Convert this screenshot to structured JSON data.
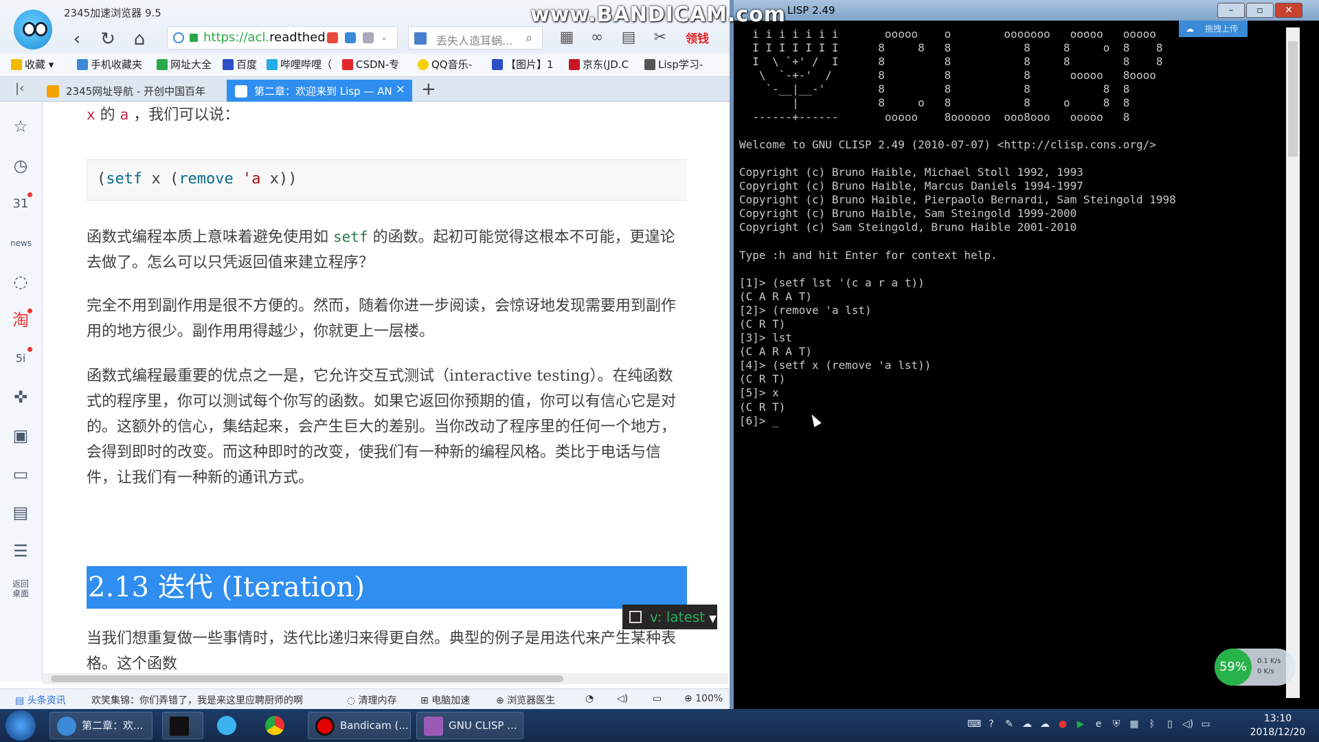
{
  "browser": {
    "title": "2345加速浏览器 9.5",
    "url_prefix": "https://acl.",
    "url_host": "readthed",
    "search_placeholder": "丢失人造耳蜗...",
    "red_button": "领钱",
    "bookmarks": [
      "收藏",
      "手机收藏夹",
      "网址大全",
      "百度",
      "哔哩哔哩（",
      "CSDN-专",
      "QQ音乐-",
      "【图片】1",
      "京东(JD.C",
      "Lisp学习-"
    ],
    "tabs": [
      {
        "label": "2345网址导航 - 开创中国百年"
      },
      {
        "label": "第二章：欢迎来到 Lisp — AN"
      }
    ],
    "content": {
      "p0_a": "x",
      "p0_b": " 的 ",
      "p0_c": "a",
      "p0_d": " ，我们可以说：",
      "code_open": "(",
      "code_setf": "setf",
      "code_x": " x (",
      "code_remove": "remove",
      "code_sp": " ",
      "code_a": "'a",
      "code_close": " x))",
      "p1_a": "函数式编程本质上意味着避免使用如 ",
      "p1_code": "setf",
      "p1_b": " 的函数。起初可能觉得这根本不可能，更遑论去做了。怎么可以只凭返回值来建立程序？",
      "p2": "完全不用到副作用是很不方便的。然而，随着你进一步阅读，会惊讶地发现需要用到副作用的地方很少。副作用用得越少，你就更上一层楼。",
      "p3": "函数式编程最重要的优点之一是，它允许交互式测试（interactive testing）。在纯函数式的程序里，你可以测试每个你写的函数。如果它返回你预期的值，你可以有信心它是对的。这额外的信心，集结起来，会产生巨大的差别。当你改动了程序里的任何一个地方，会得到即时的改变。而这种即时的改变，使我们有一种新的编程风格。类比于电话与信件，让我们有一种新的通讯方式。",
      "heading": "2.13 迭代 (Iteration)",
      "p4": "当我们想重复做一些事情时，迭代比递归来得更自然。典型的例子是用迭代来产生某种表格。这个函数"
    },
    "version_badge": "v: latest",
    "status_items": [
      "头条资讯",
      "欢笑集锦：你们弄错了，我是来这里应聘厨师的啊",
      "清理内存",
      "电脑加速",
      "浏览器医生",
      "100%"
    ]
  },
  "watermark": "www.BANDICAM.com",
  "terminal": {
    "title": "LISP 2.49",
    "upload_label": "拖拽上传",
    "lines": [
      "  i i i i i i i       ooooo    o        ooooooo   ooooo   ooooo",
      "  I I I I I I I      8     8   8           8     8     o  8    8",
      "  I  \\ `+' /  I      8         8           8     8        8    8",
      "   \\  `-+-'  /       8         8           8      ooooo   8oooo",
      "    `-__|__-'        8         8           8           8  8",
      "        |            8     o   8           8     o     8  8",
      "  ------+------       ooooo    8oooooo  ooo8ooo   ooooo   8",
      "",
      "Welcome to GNU CLISP 2.49 (2010-07-07) <http://clisp.cons.org/>",
      "",
      "Copyright (c) Bruno Haible, Michael Stoll 1992, 1993",
      "Copyright (c) Bruno Haible, Marcus Daniels 1994-1997",
      "Copyright (c) Bruno Haible, Pierpaolo Bernardi, Sam Steingold 1998",
      "Copyright (c) Bruno Haible, Sam Steingold 1999-2000",
      "Copyright (c) Sam Steingold, Bruno Haible 2001-2010",
      "",
      "Type :h and hit Enter for context help.",
      "",
      "[1]> (setf lst '(c a r a t))",
      "(C A R A T)",
      "[2]> (remove 'a lst)",
      "(C R T)",
      "[3]> lst",
      "(C A R A T)",
      "[4]> (setf x (remove 'a lst))",
      "(C R T)",
      "[5]> x",
      "(C R T)",
      "[6]> _"
    ],
    "net_percent": "59%",
    "net_up": "0.1 K/s",
    "net_down": "0 K/s"
  },
  "taskbar": {
    "tasks": [
      "第二章：欢...",
      "",
      "",
      "",
      "Bandicam (...",
      "GNU CLISP ..."
    ],
    "time": "13:10",
    "date": "2018/12/20"
  },
  "colors": {
    "accent": "#2f8ef0",
    "terminal_bg": "#000000",
    "code_green": "#2c7a4b"
  }
}
